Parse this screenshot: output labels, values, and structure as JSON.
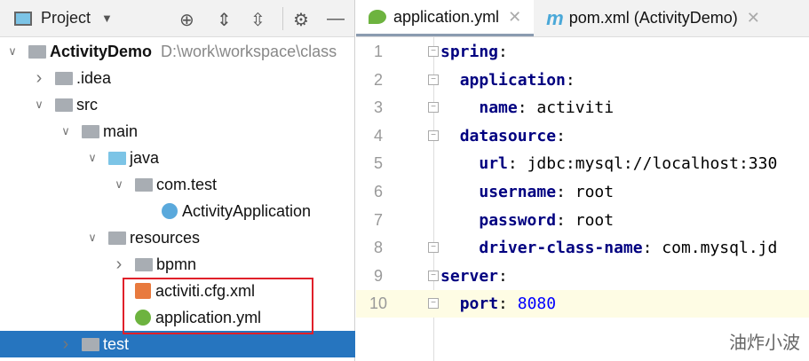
{
  "project_panel": {
    "title": "Project",
    "tree": [
      {
        "label": "ActivityDemo",
        "path": "D:\\work\\workspace\\class",
        "depth": 0,
        "arrow": "down",
        "icon": "module-folder"
      },
      {
        "label": ".idea",
        "depth": 1,
        "arrow": "right",
        "icon": "folder"
      },
      {
        "label": "src",
        "depth": 1,
        "arrow": "down",
        "icon": "folder"
      },
      {
        "label": "main",
        "depth": 2,
        "arrow": "down",
        "icon": "folder"
      },
      {
        "label": "java",
        "depth": 3,
        "arrow": "down",
        "icon": "source-folder"
      },
      {
        "label": "com.test",
        "depth": 4,
        "arrow": "down",
        "icon": "package"
      },
      {
        "label": "ActivityApplication",
        "depth": 5,
        "arrow": "",
        "icon": "spring-class"
      },
      {
        "label": "resources",
        "depth": 3,
        "arrow": "down",
        "icon": "resources-folder"
      },
      {
        "label": "bpmn",
        "depth": 4,
        "arrow": "right",
        "icon": "folder"
      },
      {
        "label": "activiti.cfg.xml",
        "depth": 4,
        "arrow": "",
        "icon": "xml-file"
      },
      {
        "label": "application.yml",
        "depth": 4,
        "arrow": "",
        "icon": "yml-file"
      },
      {
        "label": "test",
        "depth": 2,
        "arrow": "right",
        "icon": "folder",
        "selected": true
      }
    ]
  },
  "tabs": [
    {
      "label": "application.yml",
      "active": true
    },
    {
      "label": "pom.xml (ActivityDemo)"
    }
  ],
  "code": [
    {
      "n": "1",
      "indent": "",
      "key": "spring",
      "val": ""
    },
    {
      "n": "2",
      "indent": "  ",
      "key": "application",
      "val": ""
    },
    {
      "n": "3",
      "indent": "    ",
      "key": "name",
      "val": "activiti"
    },
    {
      "n": "4",
      "indent": "  ",
      "key": "datasource",
      "val": ""
    },
    {
      "n": "5",
      "indent": "    ",
      "key": "url",
      "val": "jdbc:mysql://localhost:330"
    },
    {
      "n": "6",
      "indent": "    ",
      "key": "username",
      "val": "root"
    },
    {
      "n": "7",
      "indent": "    ",
      "key": "password",
      "val": "root"
    },
    {
      "n": "8",
      "indent": "    ",
      "key": "driver-class-name",
      "val": "com.mysql.jd"
    },
    {
      "n": "9",
      "indent": "",
      "key": "server",
      "val": ""
    },
    {
      "n": "10",
      "indent": "  ",
      "key": "port",
      "val": "8080",
      "current": true
    }
  ],
  "watermark": "油炸小波"
}
